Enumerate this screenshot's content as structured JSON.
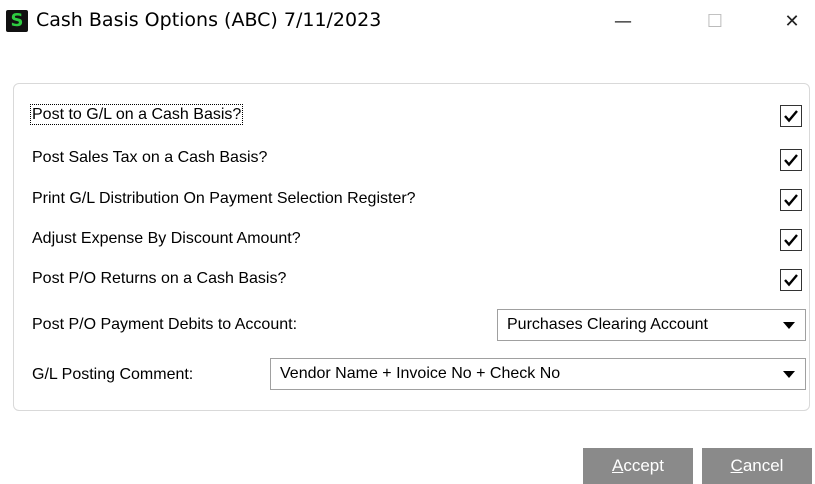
{
  "window": {
    "title": "Cash Basis Options (ABC) 7/11/2023",
    "app_icon_letter": "S",
    "minimize_glyph": "—",
    "maximize_glyph": "☐",
    "close_glyph": "✕"
  },
  "options": [
    {
      "label": "Post to G/L on a Cash Basis?",
      "checked": true
    },
    {
      "label": "Post Sales Tax on a Cash Basis?",
      "checked": true
    },
    {
      "label": "Print G/L Distribution On Payment Selection Register?",
      "checked": true
    },
    {
      "label": "Adjust Expense By Discount Amount?",
      "checked": true
    },
    {
      "label": "Post P/O Returns on a Cash Basis?",
      "checked": true
    }
  ],
  "payment_debits": {
    "label": "Post P/O Payment Debits to Account:",
    "value": "Purchases Clearing Account"
  },
  "posting_comment": {
    "label": "G/L Posting Comment:",
    "value": "Vendor Name + Invoice No + Check No"
  },
  "buttons": {
    "accept": {
      "mnemonic": "A",
      "rest": "ccept"
    },
    "cancel": {
      "mnemonic": "C",
      "rest": "ancel"
    }
  }
}
